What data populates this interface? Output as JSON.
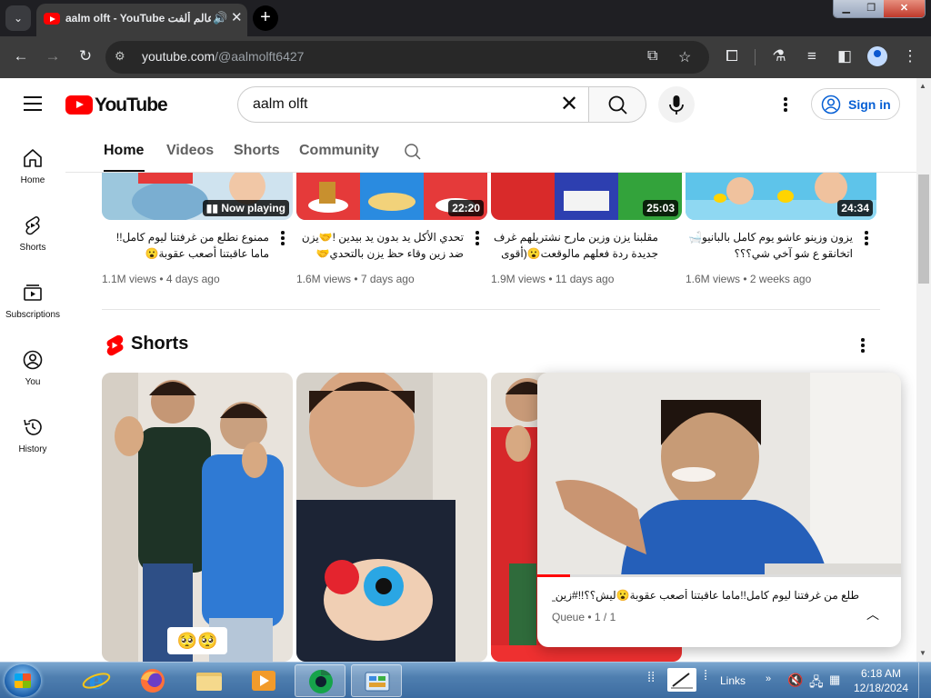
{
  "browser": {
    "tab": {
      "title": "aalm olft - YouTube عالم ألفت",
      "audio_icon": "speaker-icon",
      "close_icon": "close-icon"
    },
    "new_tab_icon": "plus-icon",
    "address": {
      "host": "youtube.com",
      "path": "/@aalmolft6427"
    }
  },
  "youtube": {
    "logo_text": "YouTube",
    "search": {
      "query": "aalm olft"
    },
    "sign_in_label": "Sign in",
    "guide": [
      {
        "label": "Home",
        "icon": "home-icon"
      },
      {
        "label": "Shorts",
        "icon": "shorts-icon"
      },
      {
        "label": "Subscriptions",
        "icon": "subscriptions-icon"
      },
      {
        "label": "You",
        "icon": "you-icon"
      },
      {
        "label": "History",
        "icon": "history-icon"
      }
    ],
    "channel_tabs": [
      "Home",
      "Videos",
      "Shorts",
      "Community"
    ],
    "videos": [
      {
        "title": "ممنوع نطلع من غرفتنا ليوم كامل!!ماما عاقبتنا أصعب عقوبة😮",
        "views": "1.1M views",
        "age": "4 days ago",
        "badge": "Now playing"
      },
      {
        "title": "تحدي الأكل يد بدون يد بيدين !🤝يزن ضد زين وقاء حظ يزن بالتحدي🤝(أقوى...",
        "views": "1.6M views",
        "age": "7 days ago",
        "badge": "22:20"
      },
      {
        "title": "مقلبنا يزن وزين مارح نشتريلهم غرف جديدة ردة فعلهم مالوقعت😮(أقوى مقلب...",
        "views": "1.9M views",
        "age": "11 days ago",
        "badge": "25:03"
      },
      {
        "title": "يزون وزينو عاشو يوم كامل بالبانيو🛁اتخانقو ع شو آخي شي؟؟؟#زين_وألفت",
        "views": "1.6M views",
        "age": "2 weeks ago",
        "badge": "24:34"
      }
    ],
    "meta_separator": " • ",
    "shorts_section_title": "Shorts",
    "shorts_badge": "🥺🥺",
    "miniplayer": {
      "title": "طلع من غرفتنا ليوم كامل!!ماما عاقبتنا أصعب عقوبة😮ليش؟؟!!#زين_وألفت",
      "queue": "Queue • 1 / 1",
      "progress": 0.09
    }
  },
  "taskbar": {
    "links_label": "Links",
    "time": "6:18 AM",
    "date": "12/18/2024"
  },
  "colors": {
    "youtube_red": "#ff0000",
    "link_blue": "#065fd4",
    "chrome_dark": "#3c3c3c"
  }
}
